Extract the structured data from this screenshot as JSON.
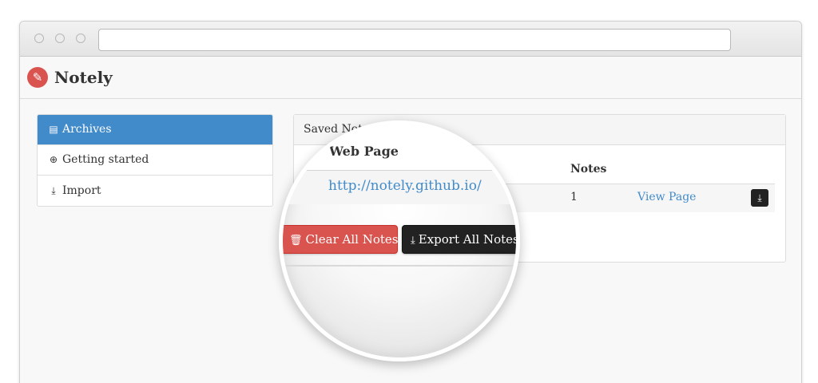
{
  "app": {
    "brand": "Notely",
    "logo_icon": "feather-icon",
    "brand_color": "#d9534f"
  },
  "browser": {
    "url": ""
  },
  "sidebar": {
    "items": [
      {
        "label": "Archives",
        "icon": "archive-icon",
        "active": true
      },
      {
        "label": "Getting started",
        "icon": "lifebuoy-icon",
        "active": false
      },
      {
        "label": "Import",
        "icon": "import-icon",
        "active": false
      }
    ],
    "active_color": "#428bca"
  },
  "panel": {
    "heading": "Saved Notes",
    "columns": [
      "Web Page",
      "Notes"
    ],
    "rows": [
      {
        "web_page": "http://notely.github.io/",
        "notes": "1",
        "action": "View Page"
      }
    ]
  },
  "buttons": {
    "clear_all": "Clear All Notes",
    "export_all": "Export All Notes"
  }
}
